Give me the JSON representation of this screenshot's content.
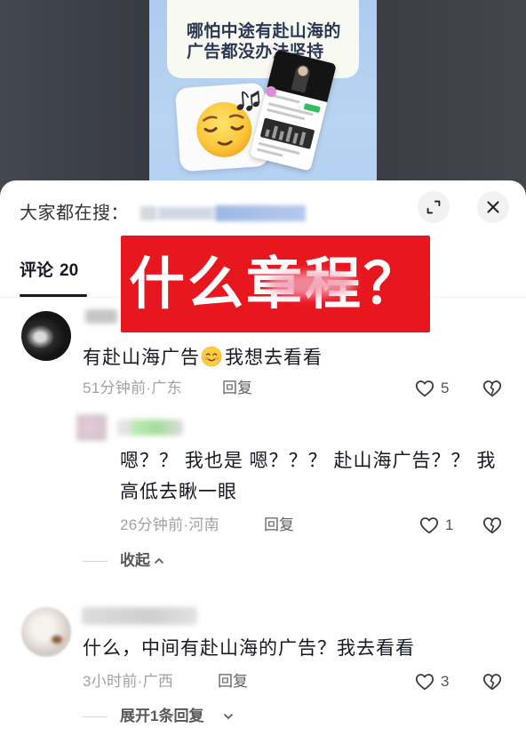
{
  "colors": {
    "accent_red": "#e8161f",
    "card_blue": "#b7d2f0",
    "meta_gray": "#a2a2a2",
    "text_dark": "#161823"
  },
  "video": {
    "card_text_lines": [
      "哪怕中途有赴山海的",
      "广告都没办法坚持"
    ],
    "emoji_icon": "relieved-face-with-music-notes-icon"
  },
  "search_bar": {
    "prefix": "大家都在搜："
  },
  "header_icons": {
    "expand": "expand-icon",
    "close": "close-icon"
  },
  "tab": {
    "label": "评论",
    "count": "20"
  },
  "overlay_banner": {
    "text": "什么章程？"
  },
  "comments": [
    {
      "text_before": "有赴山海广告",
      "emoji": "smiling-face-emoji-icon",
      "text_after": "我想去看看",
      "time_location": "51分钟前·广东",
      "reply_label": "回复",
      "likes": "5",
      "replies": [
        {
          "text_lines": [
            "嗯？？ 我也是 嗯？？？ 赴山海广告？？ 我",
            "高低去瞅一眼"
          ],
          "time_location": "26分钟前·河南",
          "reply_label": "回复",
          "likes": "1"
        }
      ],
      "collapse_label": "收起"
    },
    {
      "text": "什么，中间有赴山海的广告？我去看看",
      "time_location": "3小时前·广西",
      "reply_label": "回复",
      "likes": "3",
      "expand_label": "展开1条回复"
    }
  ]
}
